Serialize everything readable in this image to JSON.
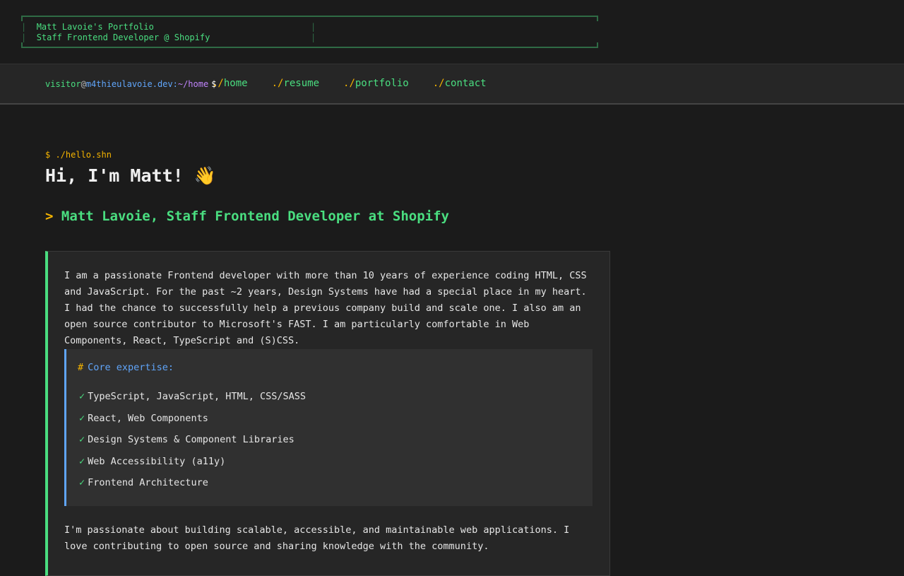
{
  "banner": {
    "line1": "Matt Lavoie's Portfolio",
    "line2": "Staff Frontend Developer @ Shopify"
  },
  "nav": {
    "prompt_user": "visitor",
    "prompt_at": "@",
    "prompt_host": "m4thieulavoie.dev:",
    "prompt_path": "~/home",
    "prompt_symbol": "$",
    "links": [
      {
        "prefix": "./",
        "label": "home"
      },
      {
        "prefix": "./",
        "label": "resume"
      },
      {
        "prefix": "./",
        "label": "portfolio"
      },
      {
        "prefix": "./",
        "label": "contact"
      }
    ]
  },
  "hero": {
    "command": "$ ./hello.shn",
    "greeting": "Hi, I'm Matt! 👋",
    "subtitle_marker": ">",
    "subtitle": "Matt Lavoie, Staff Frontend Developer at Shopify"
  },
  "about": {
    "intro": "I am a passionate Frontend developer with more than 10 years of experience coding HTML, CSS and JavaScript. For the past ~2 years, Design Systems have had a special place in my heart. I had the chance to successfully help a previous company build and scale one. I also am an open source contributor to Microsoft's FAST. I am particularly comfortable in Web Components, React, TypeScript and (S)CSS.",
    "expertise_hash": "#",
    "expertise_title": "Core expertise:",
    "check_glyph": "✓",
    "expertise": [
      "TypeScript, JavaScript, HTML, CSS/SASS",
      "React, Web Components",
      "Design Systems & Component Libraries",
      "Web Accessibility (a11y)",
      "Frontend Architecture"
    ],
    "outro": "I'm passionate about building scalable, accessible, and maintainable web applications. I love contributing to open source and sharing knowledge with the community."
  },
  "colors": {
    "accent_green": "#4ade80",
    "accent_yellow": "#f5b400",
    "accent_blue": "#60a5fa",
    "accent_purple": "#c084fc",
    "background": "#1b1b1b"
  }
}
